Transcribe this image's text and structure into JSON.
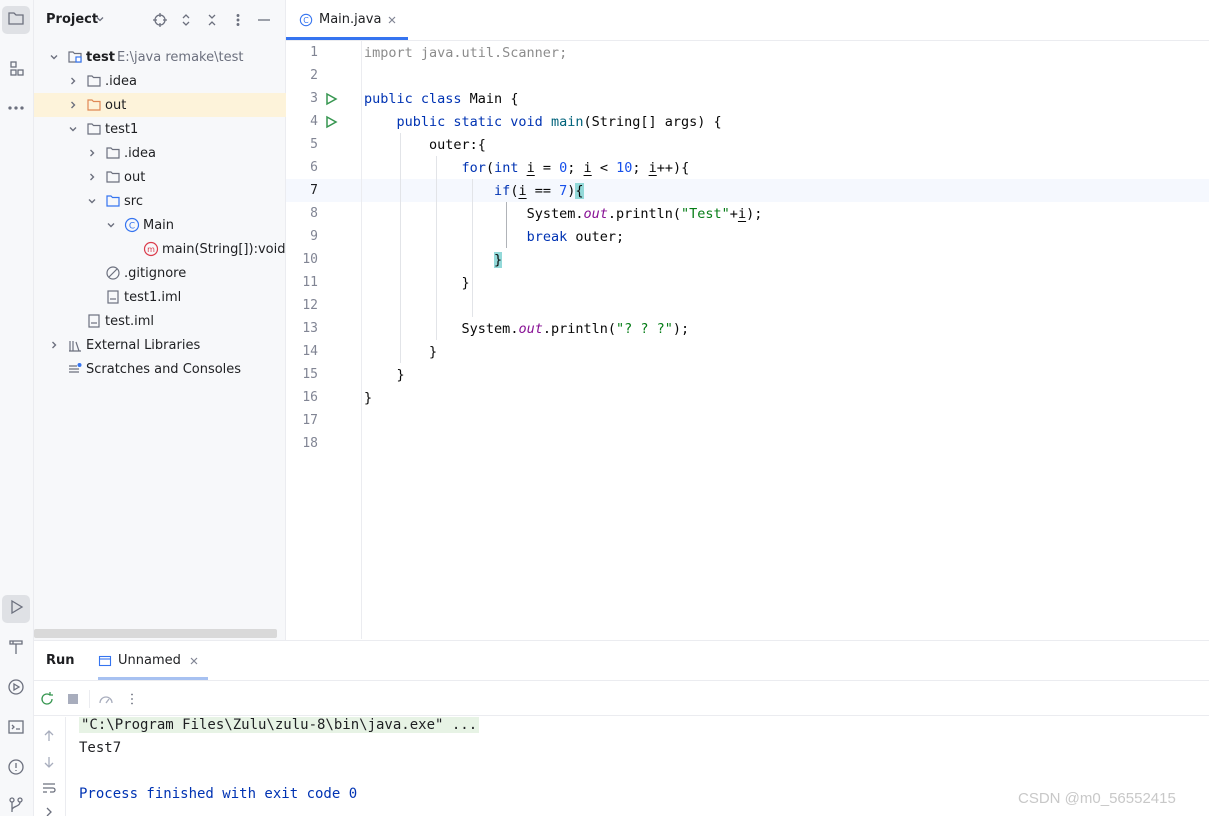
{
  "project": {
    "title": "Project",
    "tree": [
      {
        "label": "test",
        "path": "E:\\java remake\\test",
        "kind": "module",
        "expanded": true
      },
      {
        "label": ".idea",
        "kind": "folder",
        "expanded": false
      },
      {
        "label": "out",
        "kind": "folder-excluded",
        "expanded": false,
        "selected": true
      },
      {
        "label": "test1",
        "kind": "folder",
        "expanded": true
      },
      {
        "label": ".idea",
        "kind": "folder",
        "expanded": false
      },
      {
        "label": "out",
        "kind": "folder",
        "expanded": false
      },
      {
        "label": "src",
        "kind": "source-folder",
        "expanded": true
      },
      {
        "label": "Main",
        "kind": "class",
        "expanded": true
      },
      {
        "label": "main(String[]):void",
        "kind": "method"
      },
      {
        "label": ".gitignore",
        "kind": "ignore-file"
      },
      {
        "label": "test1.iml",
        "kind": "iml-file"
      },
      {
        "label": "test.iml",
        "kind": "iml-file"
      },
      {
        "label": "External Libraries",
        "kind": "libraries",
        "expanded": false
      },
      {
        "label": "Scratches and Consoles",
        "kind": "scratches"
      }
    ]
  },
  "editor": {
    "tab": {
      "label": "Main.java",
      "icon": "class-icon"
    },
    "current_line": 7,
    "line_numbers": [
      "1",
      "2",
      "3",
      "4",
      "5",
      "6",
      "7",
      "8",
      "9",
      "10",
      "11",
      "12",
      "13",
      "14",
      "15",
      "16",
      "17",
      "18"
    ],
    "code": {
      "l1": "import java.util.Scanner;",
      "l3_kw": "public class",
      "l3_rest": " Main {",
      "l4_kw": "public static void",
      "l4_name": " main",
      "l4_rest": "(String[] args) {",
      "l5": "outer:{",
      "l6_kw": "for",
      "l6_a": "(",
      "l6_int": "int",
      "l6_b": " ",
      "l6_i1": "i",
      "l6_c": " = ",
      "l6_n0": "0",
      "l6_d": "; ",
      "l6_i2": "i",
      "l6_e": " < ",
      "l6_n10": "10",
      "l6_f": "; ",
      "l6_i3": "i",
      "l6_g": "++){",
      "l7_kw": "if",
      "l7_a": "(",
      "l7_i": "i",
      "l7_b": " == ",
      "l7_n": "7",
      "l7_c": ")",
      "l7_brace": "{",
      "l8_a": "System.",
      "l8_out": "out",
      "l8_b": ".println(",
      "l8_str": "\"Test\"",
      "l8_c": "+",
      "l8_i": "i",
      "l8_d": ");",
      "l9_kw": "break",
      "l9_rest": " outer;",
      "l10": "}",
      "l11": "}",
      "l13_a": "System.",
      "l13_out": "out",
      "l13_b": ".println(",
      "l13_str": "\"? ? ?\"",
      "l13_c": ");",
      "l14": "}",
      "l15": "}",
      "l16": "}"
    }
  },
  "run": {
    "title": "Run",
    "tab_label": "Unnamed",
    "console": {
      "command": "\"C:\\Program Files\\Zulu\\zulu-8\\bin\\java.exe\" ...",
      "output": "Test7",
      "exit": "Process finished with exit code 0"
    }
  },
  "watermark": "CSDN @m0_56552415",
  "colors": {
    "accent": "#3574f0",
    "keyword": "#0033b3",
    "string": "#067d17",
    "number": "#1750eb",
    "field": "#871094",
    "run_green": "#369650"
  }
}
